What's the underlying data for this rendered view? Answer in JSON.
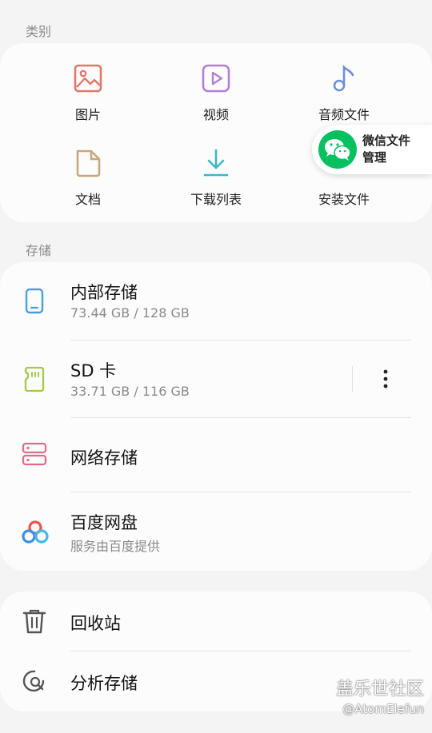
{
  "categories": {
    "header": "类别",
    "items": [
      {
        "label": "图片",
        "icon": "image-icon",
        "color": "#e0786a"
      },
      {
        "label": "视频",
        "icon": "video-icon",
        "color": "#b07fd6"
      },
      {
        "label": "音频文件",
        "icon": "music-note-icon",
        "color": "#6e8fd6"
      },
      {
        "label": "文档",
        "icon": "document-icon",
        "color": "#c9a77d"
      },
      {
        "label": "下载列表",
        "icon": "download-icon",
        "color": "#3eb8c3"
      },
      {
        "label": "安装文件",
        "icon": "apk-icon",
        "color": "#7ac170"
      }
    ]
  },
  "wechat": {
    "line1": "微信文件",
    "line2": "管理",
    "icon": "wechat-icon",
    "color": "#07c160"
  },
  "storage": {
    "header": "存储",
    "items": [
      {
        "title": "内部存储",
        "subtitle": "73.44 GB / 128 GB",
        "icon": "phone-icon",
        "color": "#4a9fd8"
      },
      {
        "title": "SD 卡",
        "subtitle": "33.71 GB / 116 GB",
        "icon": "sd-card-icon",
        "color": "#a3c94f"
      },
      {
        "title": "网络存储",
        "icon": "network-storage-icon",
        "color": "#e06b8a"
      },
      {
        "title": "百度网盘",
        "subtitle": "服务由百度提供",
        "icon": "baidu-netdisk-icon"
      }
    ]
  },
  "tools": {
    "items": [
      {
        "title": "回收站",
        "icon": "trash-icon"
      },
      {
        "title": "分析存储",
        "icon": "analyze-storage-icon"
      }
    ]
  },
  "watermark": {
    "line1": "盖乐世社区",
    "line2": "@AtomElefun"
  }
}
